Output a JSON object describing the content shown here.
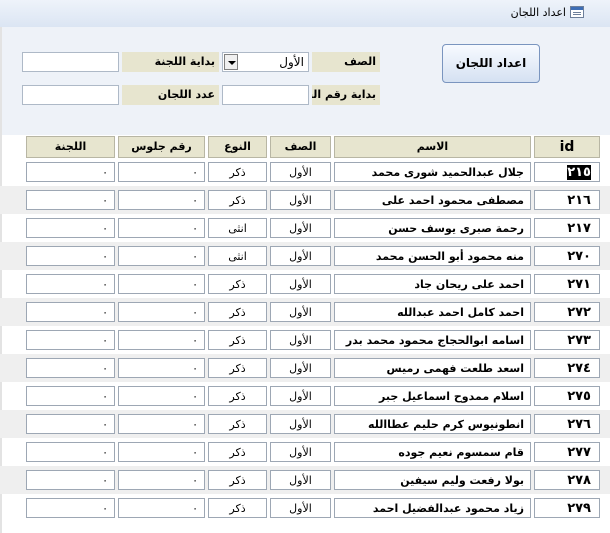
{
  "window": {
    "title": "اعداد اللجان",
    "icon": "form-icon"
  },
  "form": {
    "class_label": "الصف",
    "class_value": "الأول",
    "committee_start_label": "بداية اللجنة",
    "committee_start_value": "",
    "seat_start_label": "بداية رقم الجلوس",
    "seat_start_value": "",
    "committee_count_label": "عدد اللجان",
    "committee_count_value": "",
    "prepare_button": "اعداد اللجان"
  },
  "table": {
    "columns": {
      "id": "id",
      "name": "الاسم",
      "class": "الصف",
      "gender": "النوع",
      "seat": "رقم جلوس",
      "committee": "اللجنة"
    },
    "rows": [
      {
        "id": "٢١٥",
        "name": "جلال عبدالحميد شورى محمد",
        "class": "الأول",
        "gender": "ذكر",
        "seat": "٠",
        "committee": "٠"
      },
      {
        "id": "٢١٦",
        "name": "مصطفى محمود احمد على",
        "class": "الأول",
        "gender": "ذكر",
        "seat": "٠",
        "committee": "٠"
      },
      {
        "id": "٢١٧",
        "name": "رحمة صبرى يوسف حسن",
        "class": "الأول",
        "gender": "انثى",
        "seat": "٠",
        "committee": "٠"
      },
      {
        "id": "٢٧٠",
        "name": "منه محمود أبو الحسن محمد",
        "class": "الأول",
        "gender": "انثى",
        "seat": "٠",
        "committee": "٠"
      },
      {
        "id": "٢٧١",
        "name": "احمد على ريحان جاد",
        "class": "الأول",
        "gender": "ذكر",
        "seat": "٠",
        "committee": "٠"
      },
      {
        "id": "٢٧٢",
        "name": "احمد كامل احمد عبدالله",
        "class": "الأول",
        "gender": "ذكر",
        "seat": "٠",
        "committee": "٠"
      },
      {
        "id": "٢٧٣",
        "name": "اسامه ابوالحجاج محمود محمد بدر",
        "class": "الأول",
        "gender": "ذكر",
        "seat": "٠",
        "committee": "٠"
      },
      {
        "id": "٢٧٤",
        "name": "اسعد طلعت فهمى رميس",
        "class": "الأول",
        "gender": "ذكر",
        "seat": "٠",
        "committee": "٠"
      },
      {
        "id": "٢٧٥",
        "name": "اسلام ممدوح اسماعيل جبر",
        "class": "الأول",
        "gender": "ذكر",
        "seat": "٠",
        "committee": "٠"
      },
      {
        "id": "٢٧٦",
        "name": "انطونيوس كرم حليم عطاالله",
        "class": "الأول",
        "gender": "ذكر",
        "seat": "٠",
        "committee": "٠"
      },
      {
        "id": "٢٧٧",
        "name": "قام سمسوم نعيم جوده",
        "class": "الأول",
        "gender": "ذكر",
        "seat": "٠",
        "committee": "٠"
      },
      {
        "id": "٢٧٨",
        "name": "بولا رفعت وليم سيفين",
        "class": "الأول",
        "gender": "ذكر",
        "seat": "٠",
        "committee": "٠"
      },
      {
        "id": "٢٧٩",
        "name": "زياد محمود عبدالفضيل احمد",
        "class": "الأول",
        "gender": "ذكر",
        "seat": "٠",
        "committee": "٠"
      }
    ]
  }
}
